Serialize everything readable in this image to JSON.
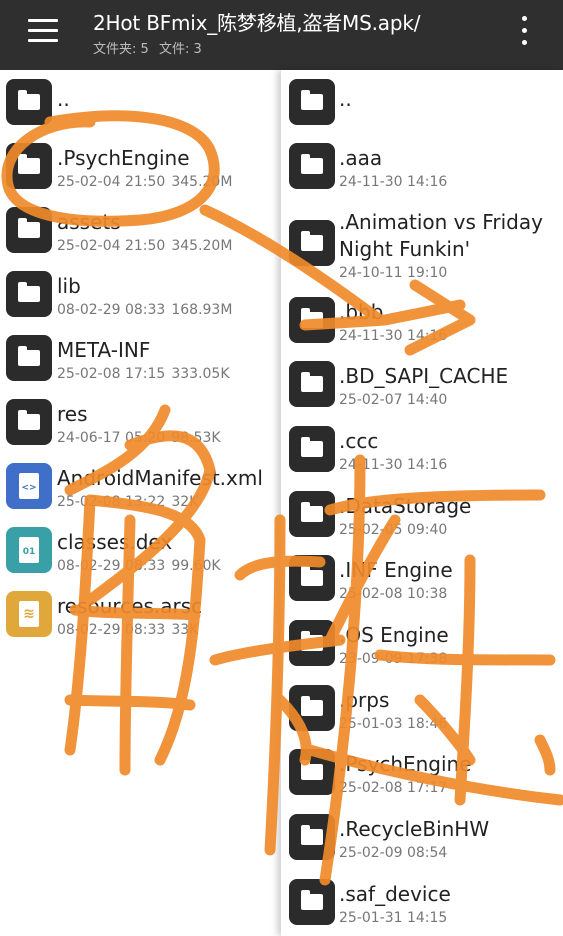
{
  "appbar": {
    "title": "2Hot BFmix_陈梦移植,盗者MS.apk/",
    "folder_count": "文件夹: 5",
    "file_count": "文件: 3"
  },
  "left_pane": {
    "items": [
      {
        "name": "..",
        "date": "",
        "size": "",
        "icon": "folder-icon"
      },
      {
        "name": ".PsychEngine",
        "date": "25-02-04 21:50",
        "size": "345.20M",
        "icon": "folder-icon"
      },
      {
        "name": "assets",
        "date": "25-02-04 21:50",
        "size": "345.20M",
        "icon": "folder-icon"
      },
      {
        "name": "lib",
        "date": "08-02-29 08:33",
        "size": "168.93M",
        "icon": "folder-icon"
      },
      {
        "name": "META-INF",
        "date": "25-02-08 17:15",
        "size": "333.05K",
        "icon": "folder-icon"
      },
      {
        "name": "res",
        "date": "24-06-17 05:20",
        "size": "98.53K",
        "icon": "folder-icon"
      },
      {
        "name": "AndroidManifest.xml",
        "date": "25-02-08 13:22",
        "size": "32K",
        "icon": "xml-file-icon",
        "color": "#3f6fc9",
        "glyph": "<>"
      },
      {
        "name": "classes.dex",
        "date": "08-02-29 08:33",
        "size": "99.60K",
        "icon": "dex-file-icon",
        "color": "#3aa0a8",
        "glyph": "01"
      },
      {
        "name": "resources.arsc",
        "date": "08-02-29 08:33",
        "size": "33K",
        "icon": "layers-file-icon",
        "color": "#e0a83a",
        "glyph": "≋"
      }
    ]
  },
  "right_pane": {
    "items": [
      {
        "name": "..",
        "date": ""
      },
      {
        "name": ".aaa",
        "date": "24-11-30 14:16"
      },
      {
        "name": ".Animation vs Friday",
        "name2": "Night Funkin'",
        "date": "24-10-11 19:10"
      },
      {
        "name": ".bbb",
        "date": "24-11-30 14:16"
      },
      {
        "name": ".BD_SAPI_CACHE",
        "date": "25-02-07 14:40"
      },
      {
        "name": ".ccc",
        "date": "24-11-30 14:16"
      },
      {
        "name": ".DataStorage",
        "date": "25-02-05 09:40"
      },
      {
        "name": ".INF Engine",
        "date": "25-02-08 10:38"
      },
      {
        "name": ".OS Engine",
        "date": "23-09-09 17:38"
      },
      {
        "name": ".prps",
        "date": "25-01-03 18:46"
      },
      {
        "name": ".PsychEngine",
        "date": "25-02-08 17:17"
      },
      {
        "name": ".RecycleBinHW",
        "date": "25-02-09 08:54"
      },
      {
        "name": ".saf_device",
        "date": "25-01-31 14:15"
      }
    ]
  },
  "colors": {
    "appbar": "#2f2f2f",
    "folder_tile": "#2b2b2b",
    "annotation": "#f08a2a"
  }
}
